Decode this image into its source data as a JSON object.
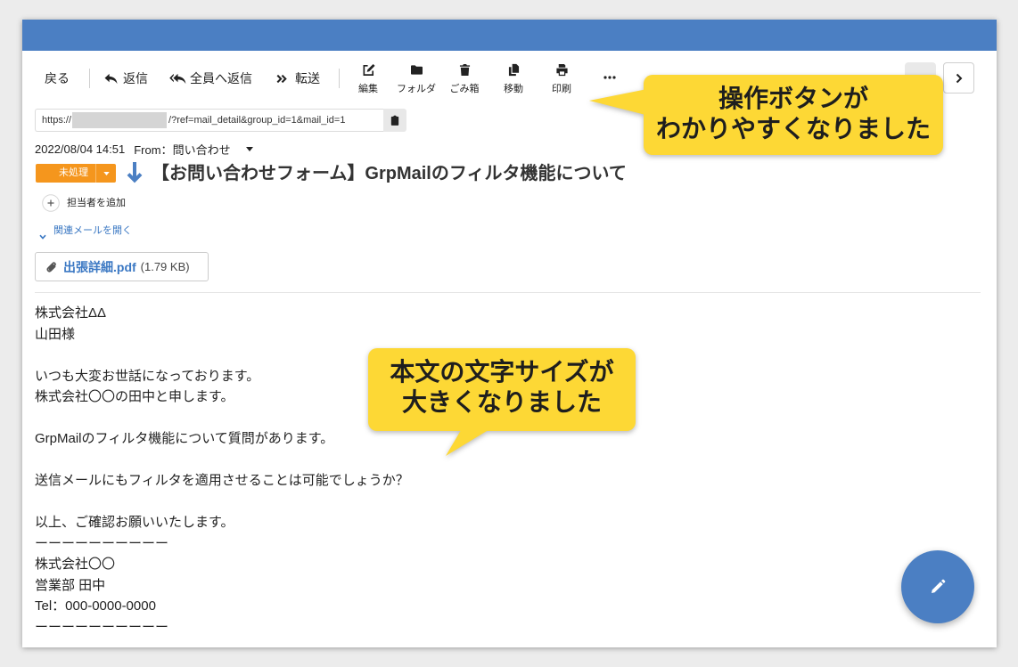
{
  "colors": {
    "accent": "#4b7fc3",
    "status": "#f5961d",
    "callout": "#fdd835",
    "link": "#3b78c3"
  },
  "toolbar": {
    "back": "戻る",
    "reply": "返信",
    "reply_all": "全員へ返信",
    "forward": "転送",
    "reply_icon": "reply-icon",
    "reply_all_icon": "reply-all-icon",
    "forward_icon": "forward-icon",
    "actions": [
      {
        "icon": "edit-icon",
        "label": "編集"
      },
      {
        "icon": "folder-icon",
        "label": "フォルダ"
      },
      {
        "icon": "trash-icon",
        "label": "ごみ箱"
      },
      {
        "icon": "move-icon",
        "label": "移動"
      },
      {
        "icon": "print-icon",
        "label": "印刷"
      }
    ],
    "more_icon": "more-icon",
    "next_icon": "chevron-right-icon"
  },
  "url_bar": {
    "scheme": "https://",
    "path": "/?ref=mail_detail&group_id=1&mail_id=1",
    "copy_icon": "clipboard-icon"
  },
  "mail": {
    "datetime": "2022/08/04 14:51",
    "from_label": "From：",
    "from_name": "問い合わせ",
    "status": "未処理",
    "priority_icon": "arrow-down-icon",
    "subject": "【お問い合わせフォーム】GrpMailのフィルタ機能について",
    "add_assignee": "担当者を追加",
    "open_related": "関連メールを開く",
    "attachment": {
      "icon": "paperclip-icon",
      "name": "出張詳細.pdf",
      "size": "(1.79 KB)"
    },
    "body": [
      [
        "株式会社ΔΔ",
        "山田様"
      ],
      [
        "いつも大変お世話になっております。",
        "株式会社〇〇の田中と申します。"
      ],
      [
        "GrpMailのフィルタ機能について質問があります。"
      ],
      [
        "送信メールにもフィルタを適用させることは可能でしょうか？"
      ],
      [
        "以上、ご確認お願いいたします。",
        "ーーーーーーーーーー",
        "株式会社〇〇",
        "営業部 田中",
        "Tel：000-0000-0000",
        "ーーーーーーーーーー"
      ]
    ]
  },
  "compose_icon": "pencil-icon",
  "callouts": [
    {
      "lines": [
        "操作ボタンが",
        "わかりやすくなりました"
      ]
    },
    {
      "lines": [
        "本文の文字サイズが",
        "大きくなりました"
      ]
    }
  ]
}
